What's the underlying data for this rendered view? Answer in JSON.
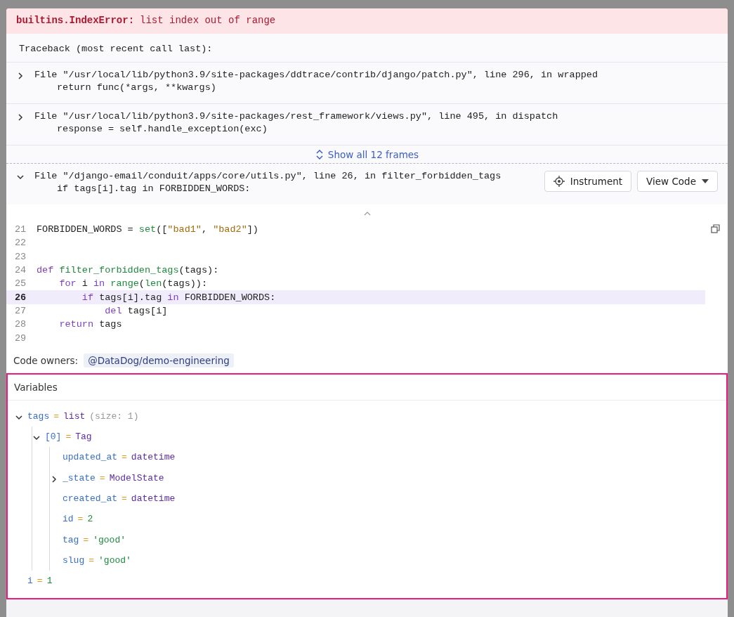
{
  "error": {
    "type": "builtins.IndexError:",
    "message": "list index out of range"
  },
  "traceback_title": "Traceback (most recent call last):",
  "frames": [
    {
      "location": "File \"/usr/local/lib/python3.9/site-packages/ddtrace/contrib/django/patch.py\", line 296, in wrapped",
      "code": "return func(*args, **kwargs)",
      "expanded": false
    },
    {
      "location": "File \"/usr/local/lib/python3.9/site-packages/rest_framework/views.py\", line 495, in dispatch",
      "code": "response = self.handle_exception(exc)",
      "expanded": false
    }
  ],
  "show_all": "Show all 12 frames",
  "active_frame": {
    "location": "File \"/django-email/conduit/apps/core/utils.py\", line 26, in filter_forbidden_tags",
    "code": "if tags[i].tag in FORBIDDEN_WORDS:",
    "expanded": true,
    "buttons": [
      {
        "label": "Instrument",
        "kind": "icon"
      },
      {
        "label": "View Code",
        "kind": "dropdown"
      }
    ]
  },
  "source_lines": [
    {
      "number": "21",
      "highlighted": false,
      "tokens": [
        {
          "text": "FORBIDDEN_WORDS = ",
          "kind": "plain"
        },
        {
          "text": "set",
          "kind": "func"
        },
        {
          "text": "([",
          "kind": "plain"
        },
        {
          "text": "\"bad1\"",
          "kind": "string"
        },
        {
          "text": ", ",
          "kind": "plain"
        },
        {
          "text": "\"bad2\"",
          "kind": "string"
        },
        {
          "text": "])",
          "kind": "plain"
        }
      ]
    },
    {
      "number": "22",
      "highlighted": false
    },
    {
      "number": "23",
      "highlighted": false
    },
    {
      "number": "24",
      "highlighted": false,
      "tokens": [
        {
          "text": "def ",
          "kind": "keyword"
        },
        {
          "text": "filter_forbidden_tags",
          "kind": "func"
        },
        {
          "text": "(tags):",
          "kind": "plain"
        }
      ]
    },
    {
      "number": "25",
      "highlighted": false,
      "tokens": [
        {
          "text": "    for ",
          "kind": "keyword"
        },
        {
          "text": "i ",
          "kind": "plain"
        },
        {
          "text": "in ",
          "kind": "keyword"
        },
        {
          "text": "range",
          "kind": "func"
        },
        {
          "text": "(",
          "kind": "plain"
        },
        {
          "text": "len",
          "kind": "func"
        },
        {
          "text": "(tags)):",
          "kind": "plain"
        }
      ]
    },
    {
      "number": "26",
      "highlighted": true,
      "tokens": [
        {
          "text": "        if ",
          "kind": "keyword"
        },
        {
          "text": "tags[i].tag ",
          "kind": "plain"
        },
        {
          "text": "in ",
          "kind": "keyword"
        },
        {
          "text": "FORBIDDEN_WORDS:",
          "kind": "plain"
        }
      ]
    },
    {
      "number": "27",
      "highlighted": false,
      "tokens": [
        {
          "text": "            del ",
          "kind": "keyword"
        },
        {
          "text": "tags[i]",
          "kind": "plain"
        }
      ]
    },
    {
      "number": "28",
      "highlighted": false,
      "tokens": [
        {
          "text": "    return ",
          "kind": "keyword"
        },
        {
          "text": "tags",
          "kind": "plain"
        }
      ]
    },
    {
      "number": "29",
      "highlighted": false
    }
  ],
  "code_owners": {
    "label": "Code owners:",
    "team": "@DataDog/demo-engineering"
  },
  "variables": {
    "title": "Variables",
    "items": [
      {
        "name": "tags",
        "sep": "=",
        "value": "list",
        "note": "(size: 1)",
        "kind": "type",
        "expanded": true,
        "children": [
          {
            "name": "[0]",
            "sep": "=",
            "value": "Tag",
            "kind": "type",
            "expanded": true,
            "children": [
              {
                "name": "updated_at",
                "sep": "=",
                "value": "datetime",
                "kind": "type"
              },
              {
                "name": "_state",
                "sep": "=",
                "value": "ModelState",
                "kind": "type",
                "expanded": false
              },
              {
                "name": "created_at",
                "sep": "=",
                "value": "datetime",
                "kind": "type"
              },
              {
                "name": "id",
                "sep": "=",
                "value": "2",
                "kind": "literal"
              },
              {
                "name": "tag",
                "sep": "=",
                "value": "'good'",
                "kind": "literal"
              },
              {
                "name": "slug",
                "sep": "=",
                "value": "'good'",
                "kind": "literal"
              }
            ]
          }
        ]
      },
      {
        "name": "i",
        "sep": "=",
        "value": "1",
        "kind": "literal"
      }
    ]
  }
}
